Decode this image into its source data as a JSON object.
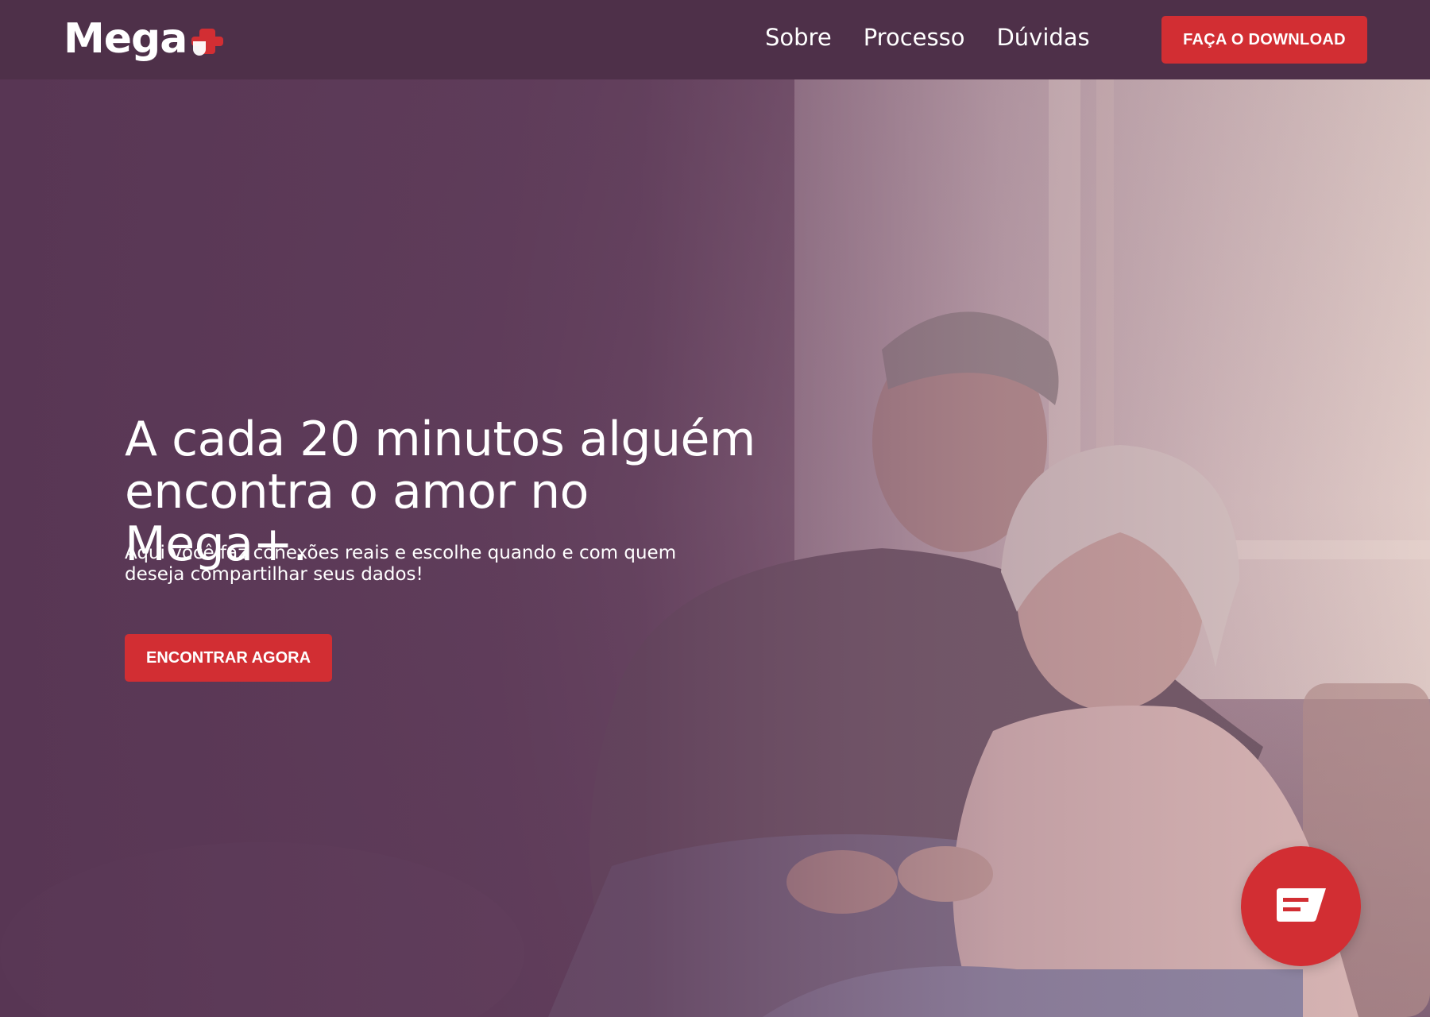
{
  "header": {
    "logo_text": "Mega",
    "nav": [
      "Sobre",
      "Processo",
      "Dúvidas"
    ],
    "download_label": "FAÇA O DOWNLOAD"
  },
  "hero": {
    "title": "A cada 20 minutos alguém encontra o amor no Mega+.",
    "subtitle": "Aqui você faz conexões reais e escolhe quando e com quem deseja compartilhar seus dados!",
    "cta_label": "ENCONTRAR AGORA"
  },
  "chat": {
    "icon": "chat-icon"
  },
  "colors": {
    "header_bg": "#4e3049",
    "accent": "#d22e33",
    "overlay": "#5a3a55",
    "text": "#ffffff"
  }
}
